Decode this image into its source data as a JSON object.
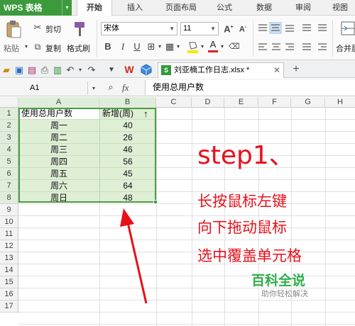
{
  "app": {
    "logo": "WPS 表格"
  },
  "menu": [
    "开始",
    "插入",
    "页面布局",
    "公式",
    "数据",
    "审阅",
    "视图"
  ],
  "ribbon": {
    "paste": "粘贴",
    "cut": "剪切",
    "copy": "复制",
    "format_painter": "格式刷",
    "font_name": "宋体",
    "font_size": "11",
    "merge": "合并居"
  },
  "doc_tab": {
    "title": "刘亚楠工作日志.xlsx *"
  },
  "formula_bar": {
    "cell_ref": "A1",
    "fx": "fx",
    "content": "使用总用户数"
  },
  "columns": [
    "A",
    "B",
    "C",
    "D",
    "E",
    "F",
    "G",
    "H"
  ],
  "rows": [
    "1",
    "2",
    "3",
    "4",
    "5",
    "6",
    "7",
    "8",
    "9",
    "10",
    "11",
    "12",
    "13",
    "14",
    "15",
    "16",
    "17"
  ],
  "table": {
    "header": [
      "使用总用户数",
      "新增(周)"
    ],
    "cells": [
      [
        "周一",
        "40"
      ],
      [
        "周二",
        "26"
      ],
      [
        "周三",
        "46"
      ],
      [
        "周四",
        "56"
      ],
      [
        "周五",
        "45"
      ],
      [
        "周六",
        "64"
      ],
      [
        "周日",
        "48"
      ]
    ]
  },
  "overlay": {
    "step": "step1、",
    "lines": [
      "长按鼠标左键",
      "向下拖动鼠标",
      "选中覆盖单元格"
    ]
  },
  "watermark": {
    "title": "百科全说",
    "subtitle": "助你轻松解决"
  },
  "colors": {
    "accent": "#3c9a3c",
    "selection_fill": "#dff0d8",
    "selection_border": "#4b9c44",
    "annotation": "#e8101a"
  }
}
